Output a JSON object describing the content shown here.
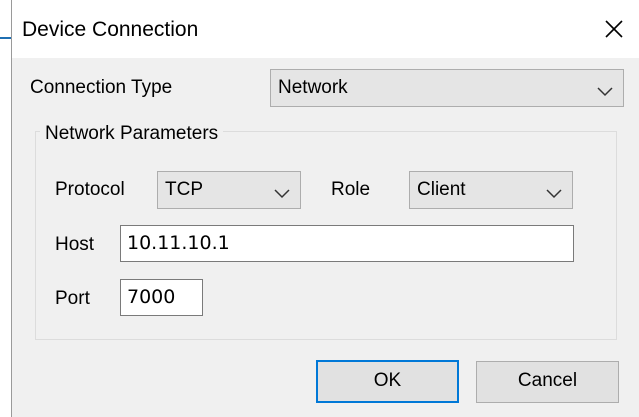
{
  "dialog": {
    "title": "Device Connection",
    "close_icon": "close-icon"
  },
  "connection": {
    "label": "Connection Type",
    "value": "Network"
  },
  "network": {
    "group_label": "Network Parameters",
    "protocol_label": "Protocol",
    "protocol_value": "TCP",
    "role_label": "Role",
    "role_value": "Client",
    "host_label": "Host",
    "host_value": "10.11.10.1",
    "port_label": "Port",
    "port_value": "7000"
  },
  "buttons": {
    "ok": "OK",
    "cancel": "Cancel"
  },
  "colors": {
    "accent": "#0078d7",
    "dialog_bg": "#f0f0f0"
  }
}
